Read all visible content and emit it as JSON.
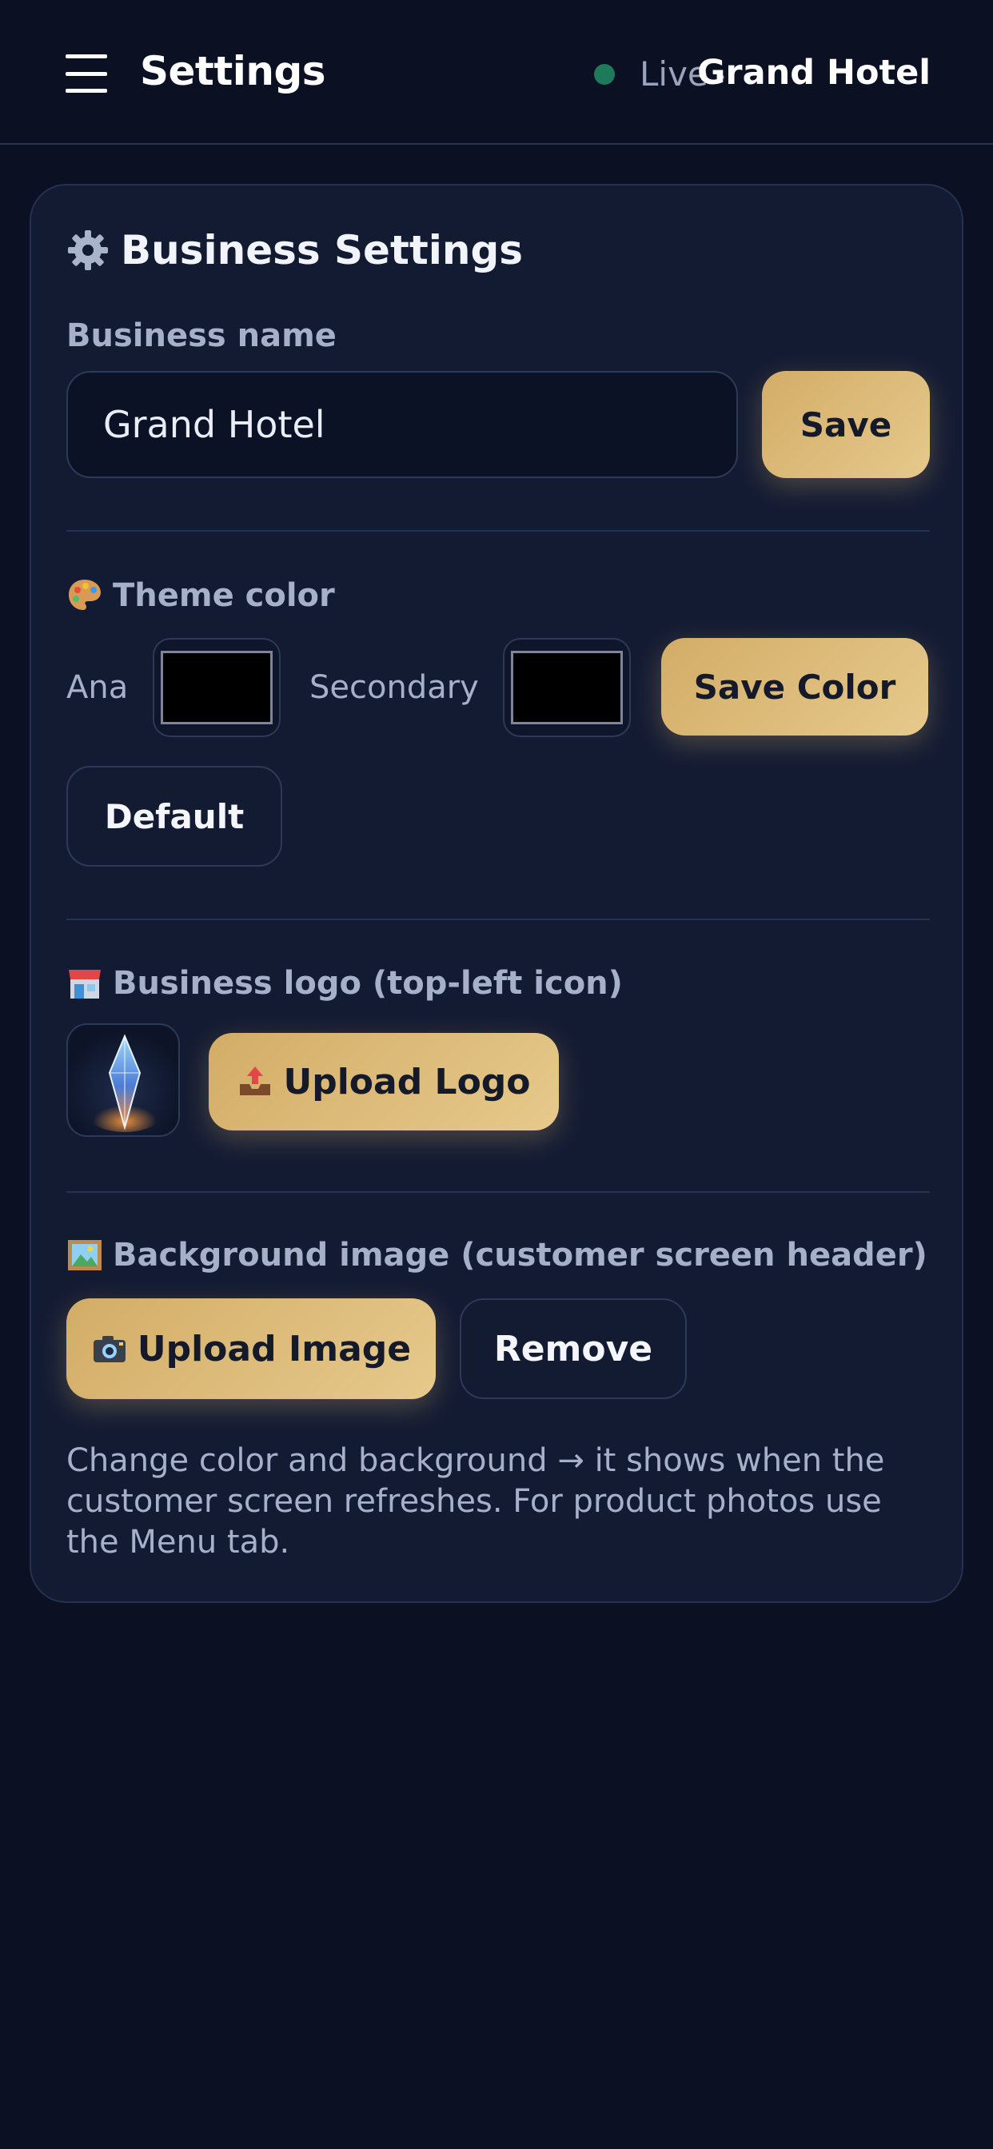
{
  "header": {
    "title": "Settings",
    "status_label": "Live",
    "status_separator": "·",
    "business_name": "Grand Hotel"
  },
  "card": {
    "title": "Business Settings",
    "title_icon": "gear-icon",
    "business_name_label": "Business name",
    "business_name_value": "Grand Hotel",
    "save_label": "Save",
    "theme": {
      "label": "Theme color",
      "icon": "palette-icon",
      "primary_label": "Ana",
      "primary_color": "#000000",
      "secondary_label": "Secondary",
      "secondary_color": "#000000",
      "save_color_label": "Save Color",
      "default_label": "Default"
    },
    "logo": {
      "label": "Business logo (top-left icon)",
      "icon": "store-icon",
      "upload_label": "Upload Logo",
      "upload_icon": "outbox-tray-icon"
    },
    "background": {
      "label": "Background image (customer screen header)",
      "icon": "framed-picture-icon",
      "upload_label": "Upload Image",
      "upload_icon": "camera-icon",
      "remove_label": "Remove"
    },
    "note": "Change color and background → it shows when the customer screen refreshes. For product photos use the Menu tab."
  },
  "colors": {
    "background": "#0b1122",
    "card": "#131b33",
    "accent_gold": "#d9b873",
    "live_dot": "#1e7a5a"
  }
}
